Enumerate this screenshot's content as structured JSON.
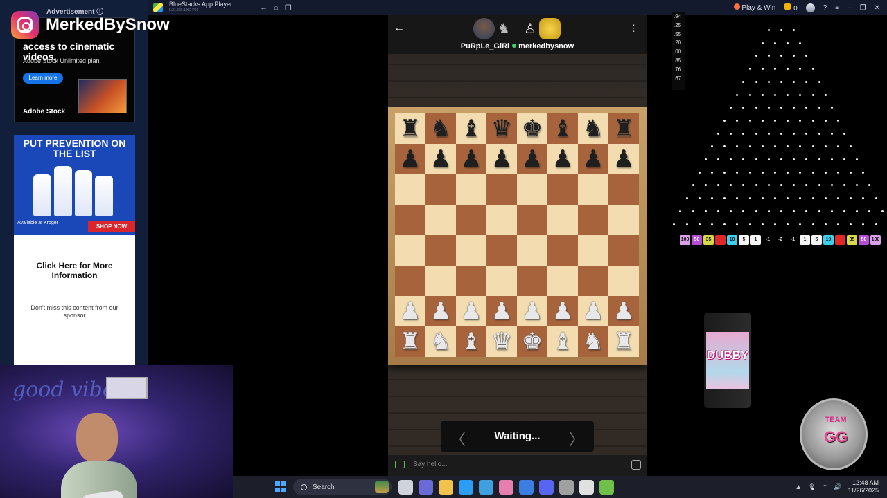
{
  "bluestacks": {
    "title": "BlueStacks App Player",
    "subtitle": "5.21.660.1002 P64",
    "play_win": "Play & Win",
    "coins": "0"
  },
  "ads": {
    "label": "Advertisement ⓘ",
    "adobe": {
      "headline": "access to cinematic videos.",
      "sub": "Adobe Stock Unlimited plan.",
      "button": "Learn more",
      "brand": "Adobe Stock"
    },
    "lysol": {
      "headline": "PUT PREVENTION ON THE LIST",
      "available": "Available at Kroger",
      "button": "SHOP NOW"
    },
    "sponsor": {
      "cta": "Click Here for More Information",
      "message": "Don't miss this content from our sponsor"
    }
  },
  "instagram": {
    "handle": "MerkedBySnow"
  },
  "webcam": {
    "neon": "good vibes"
  },
  "game": {
    "player1": "PuRpLe_GiRl",
    "player2": "merkedbysnow",
    "status": "Waiting...",
    "chat_placeholder": "Say hello...",
    "board": [
      [
        "♜",
        "♞",
        "♝",
        "♛",
        "♚",
        "♝",
        "♞",
        "♜"
      ],
      [
        "♟",
        "♟",
        "♟",
        "♟",
        "♟",
        "♟",
        "♟",
        "♟"
      ],
      [
        "",
        "",
        "",
        "",
        "",
        "",
        "",
        ""
      ],
      [
        "",
        "",
        "",
        "",
        "",
        "",
        "",
        ""
      ],
      [
        "",
        "",
        "",
        "",
        "",
        "",
        "",
        ""
      ],
      [
        "",
        "",
        "",
        "",
        "",
        "",
        "",
        ""
      ],
      [
        "♟",
        "♟",
        "♟",
        "♟",
        "♟",
        "♟",
        "♟",
        "♟"
      ],
      [
        "♜",
        "♞",
        "♝",
        "♛",
        "♚",
        "♝",
        "♞",
        "♜"
      ]
    ]
  },
  "plinko": {
    "score_list": [
      ".94",
      ".25",
      ".55",
      ".20",
      ".00",
      ".85",
      ".76",
      ".67"
    ],
    "buckets": [
      {
        "label": "100",
        "color": "#d9a0e8"
      },
      {
        "label": "50",
        "color": "#b54bd6"
      },
      {
        "label": "35",
        "color": "#d8d94a"
      },
      {
        "label": "",
        "color": "#e02828"
      },
      {
        "label": "10",
        "color": "#3ad0ee"
      },
      {
        "label": "5",
        "color": "#f4f4f4"
      },
      {
        "label": "1",
        "color": "#f4f4f4"
      },
      {
        "label": "-1",
        "color": "neg"
      },
      {
        "label": "-2",
        "color": "neg"
      },
      {
        "label": "-1",
        "color": "neg"
      },
      {
        "label": "1",
        "color": "#f4f4f4"
      },
      {
        "label": "5",
        "color": "#f4f4f4"
      },
      {
        "label": "10",
        "color": "#3ad0ee"
      },
      {
        "label": "",
        "color": "#e02828"
      },
      {
        "label": "35",
        "color": "#d8d94a"
      },
      {
        "label": "50",
        "color": "#b54bd6"
      },
      {
        "label": "100",
        "color": "#d9a0e8"
      }
    ]
  },
  "promo": {
    "can_brand": "DUBBY",
    "badge_team": "TEAM",
    "badge_gg": "GG"
  },
  "taskbar": {
    "search_placeholder": "Search",
    "time": "12:48 AM",
    "date": "11/26/2025",
    "apps": [
      "#cfd3dc",
      "#6b6bd6",
      "#f2c14e",
      "#2a9df4",
      "#3fa0e0",
      "#e47fb0",
      "#3b7de0",
      "#5865f2",
      "#a0a0a0",
      "#e0e0e0",
      "#6fbf4a"
    ]
  }
}
